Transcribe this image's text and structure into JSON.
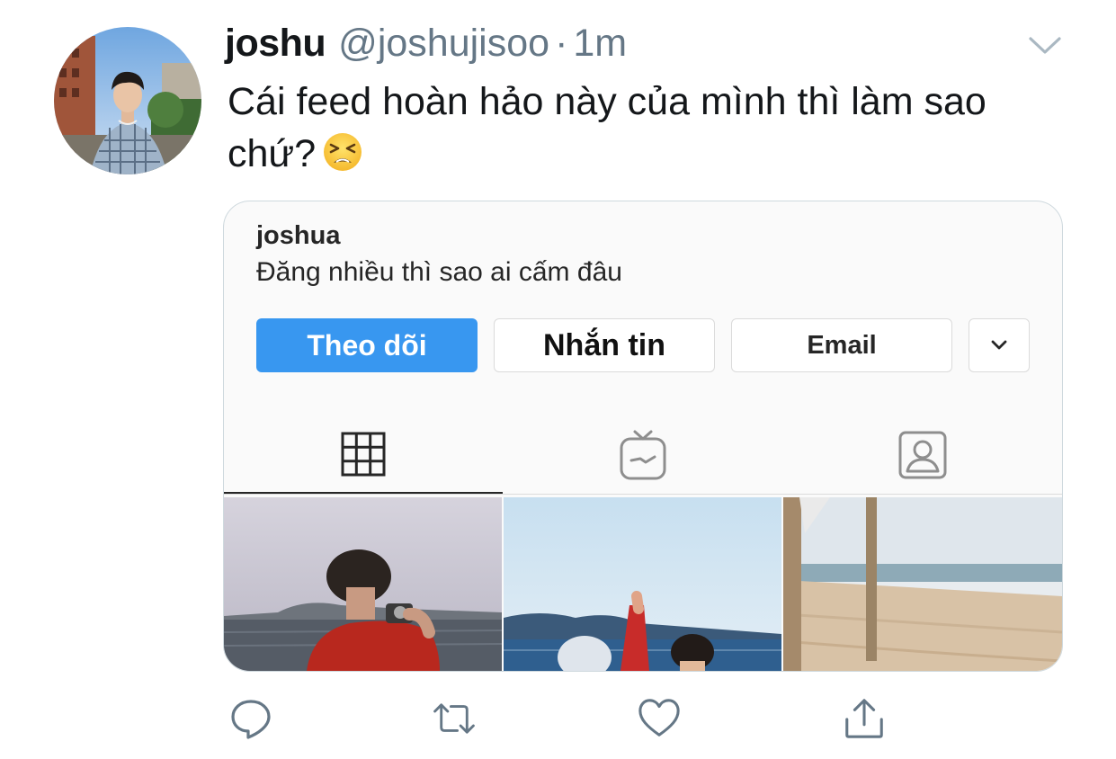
{
  "tweet": {
    "display_name": "joshu",
    "handle": "@joshujisoo",
    "separator": "·",
    "time": "1m",
    "text": "Cái feed hoàn hảo này của mình thì làm sao chứ?",
    "emoji_icon": "tired-face-emoji"
  },
  "instagram_card": {
    "username": "joshua",
    "bio": "Đăng nhiều thì sao ai cấm đâu",
    "buttons": {
      "follow": "Theo dõi",
      "message": "Nhắn tin",
      "email": "Email",
      "more_icon": "chevron-down-icon"
    },
    "tabs": [
      {
        "icon": "grid-icon",
        "active": true
      },
      {
        "icon": "igtv-icon",
        "active": false
      },
      {
        "icon": "tagged-icon",
        "active": false
      }
    ],
    "colors": {
      "follow_button": "#3897f0"
    }
  },
  "action_bar": [
    {
      "icon": "reply-icon"
    },
    {
      "icon": "retweet-icon"
    },
    {
      "icon": "like-icon"
    },
    {
      "icon": "share-icon"
    }
  ],
  "colors": {
    "secondary_text": "#657786",
    "icon_gray": "#657786"
  }
}
